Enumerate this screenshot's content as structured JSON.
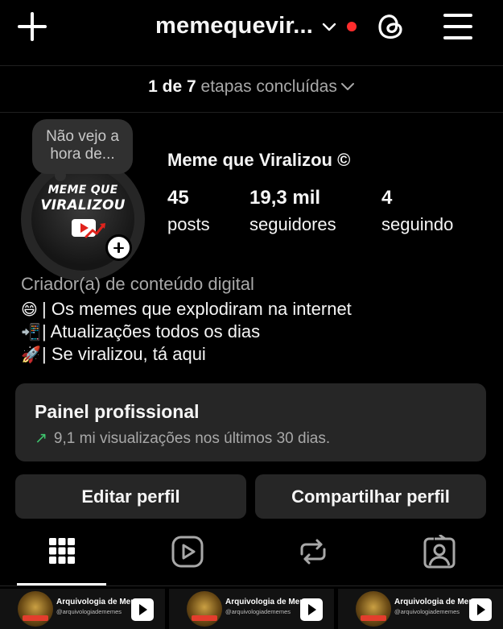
{
  "header": {
    "username": "memequevir...",
    "icons": {
      "new": "plus-icon",
      "switch": "chevron-down-icon",
      "notification": "red-dot-badge",
      "threads": "threads-icon",
      "menu": "hamburger-menu-icon"
    },
    "colors": {
      "badge": "#ff2d2d"
    }
  },
  "steps": {
    "count": "1 de 7",
    "label": "etapas concluídas"
  },
  "profile": {
    "note": "Não vejo a hora de...",
    "avatar_text": {
      "line1": "MEME QUE",
      "line2": "VIRALIZOU"
    },
    "display_name": "Meme que Viralizou ©",
    "stats": [
      {
        "value": "45",
        "label": "posts"
      },
      {
        "value": "19,3 mil",
        "label": "seguidores"
      },
      {
        "value": "4",
        "label": "seguindo"
      }
    ]
  },
  "bio": {
    "category": "Criador(a) de conteúdo digital",
    "lines": [
      {
        "emoji": "😄",
        "text": "| Os memes que explodiram na internet"
      },
      {
        "emoji": "📲",
        "text": "| Atualizações todos os dias"
      },
      {
        "emoji": "🚀",
        "text": "| Se viralizou, tá aqui"
      }
    ]
  },
  "dashboard": {
    "title": "Painel profissional",
    "subtitle": "9,1 mi visualizações nos últimos 30 dias.",
    "trend_icon": "trending-up-icon",
    "colors": {
      "trend": "#3ec46d"
    }
  },
  "buttons": {
    "edit": "Editar perfil",
    "share": "Compartilhar perfil"
  },
  "tabs": [
    {
      "icon": "grid-icon",
      "selected": true
    },
    {
      "icon": "reels-icon",
      "selected": false
    },
    {
      "icon": "reposts-icon",
      "selected": false
    },
    {
      "icon": "tagged-icon",
      "selected": false
    }
  ],
  "grid_posts": [
    {
      "title": "Arquivologia de Meme",
      "handle": "@arquivologiadememes",
      "badge_icon": "play-icon"
    },
    {
      "title": "Arquivologia de Meme",
      "handle": "@arquivologiadememes",
      "badge_icon": "play-icon"
    },
    {
      "title": "Arquivologia de Meme",
      "handle": "@arquivologiadememes",
      "badge_icon": "play-icon"
    }
  ]
}
